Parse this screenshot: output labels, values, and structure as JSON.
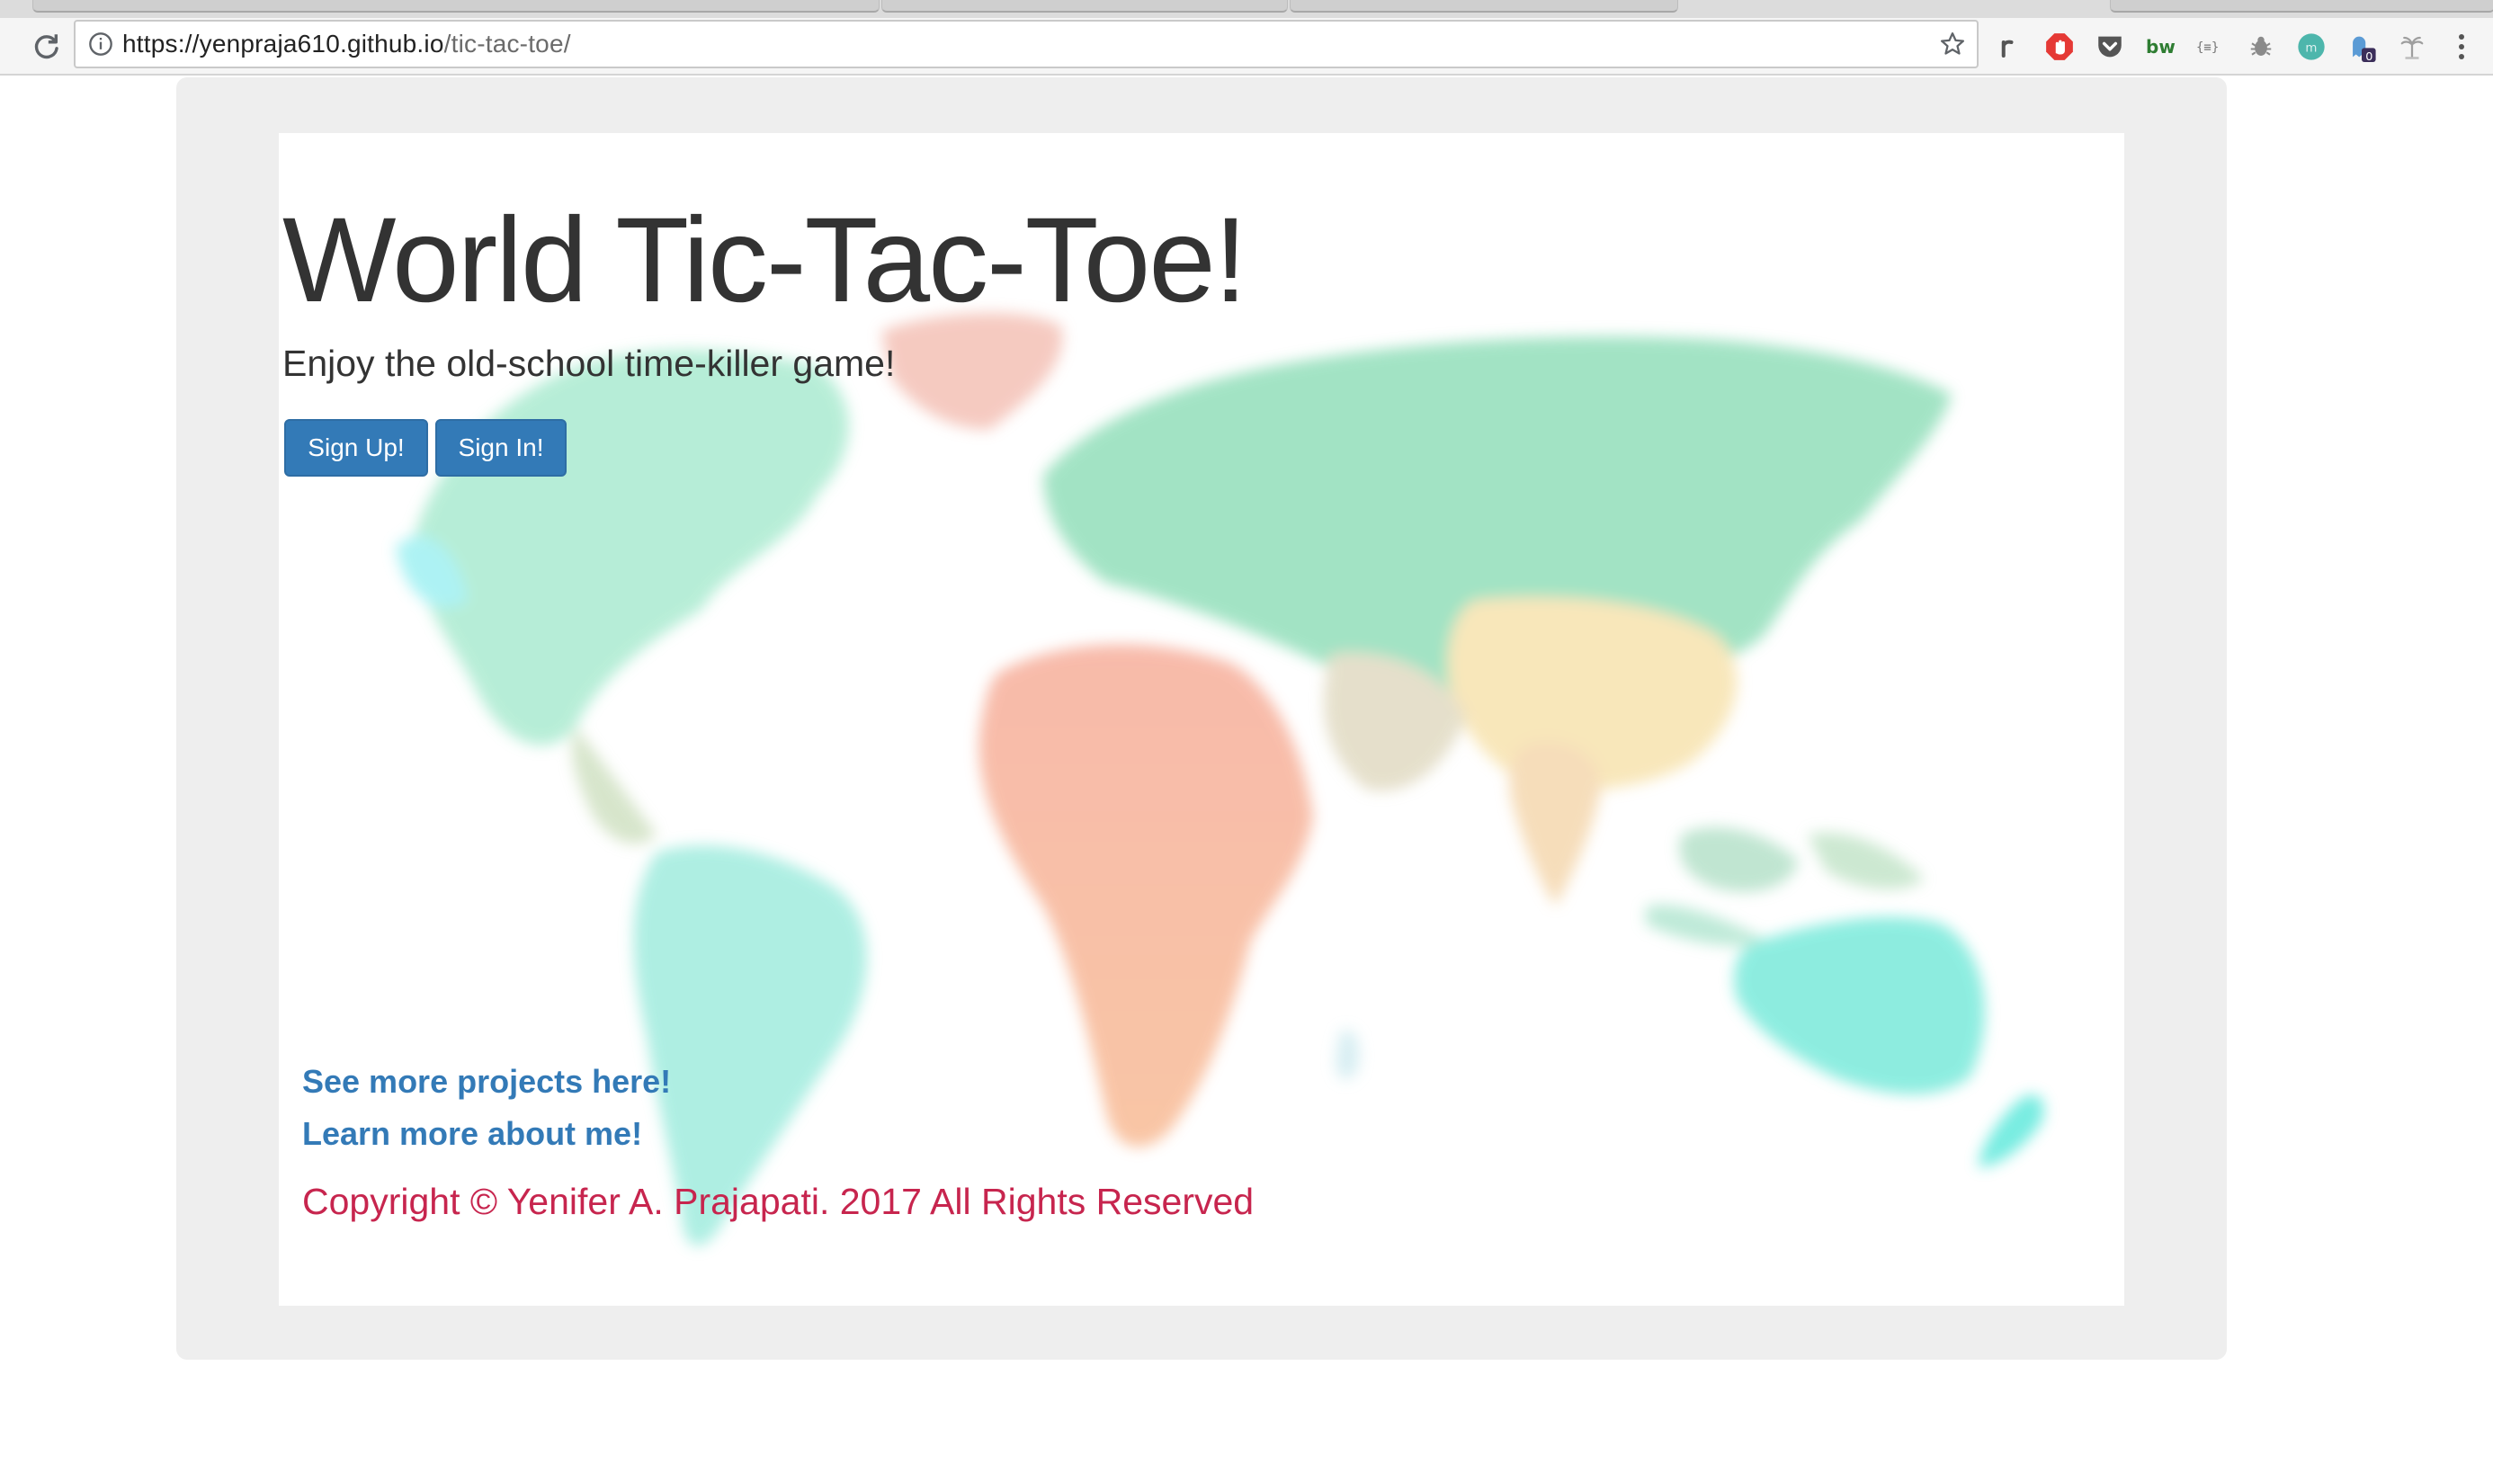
{
  "browser": {
    "url_host": "https://yenpraja610.github.io",
    "url_path": "/tic-tac-toe/",
    "extension_badge": "0"
  },
  "page": {
    "title": "World Tic-Tac-Toe!",
    "subtitle": "Enjoy the old-school time-killer game!",
    "buttons": {
      "sign_up": "Sign Up!",
      "sign_in": "Sign In!"
    },
    "links": {
      "projects": "See more projects here!",
      "about": "Learn more about me!"
    },
    "copyright": "Copyright © Yenifer A. Prajapati. 2017 All Rights Reserved"
  },
  "colors": {
    "button_primary": "#337ab7",
    "link": "#337ab7",
    "copyright": "#c7254e",
    "title": "#333333",
    "jumbotron": "#eeeeee"
  },
  "icons": [
    "reload-icon",
    "info-icon",
    "star-icon",
    "rss-icon",
    "adblock-icon",
    "pocket-icon",
    "bw-icon",
    "json-icon",
    "bug-icon",
    "avatar-icon",
    "ghostery-icon",
    "palm-icon",
    "more-icon"
  ]
}
